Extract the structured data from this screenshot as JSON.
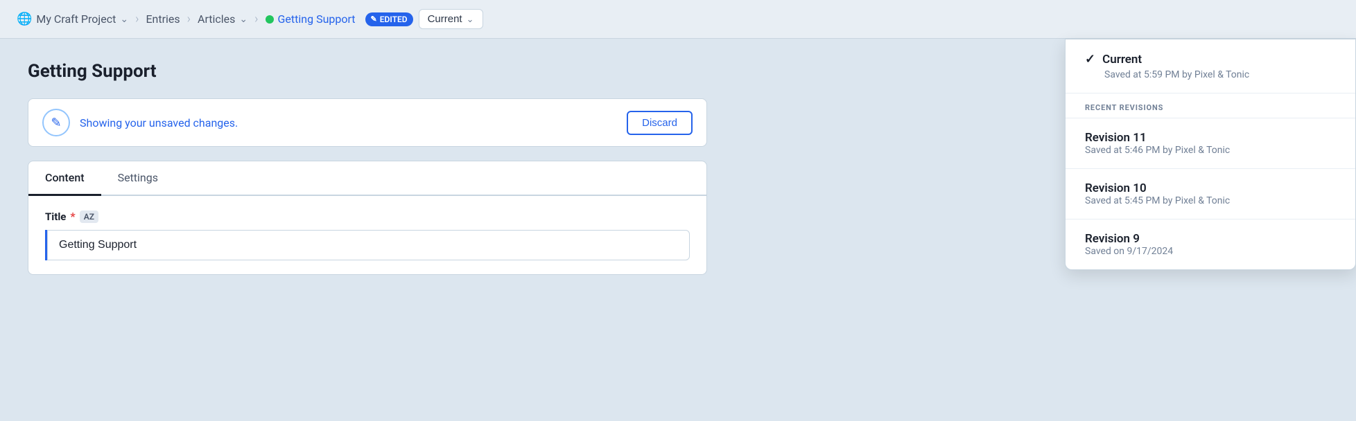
{
  "nav": {
    "project_label": "My Craft Project",
    "entries_label": "Entries",
    "articles_label": "Articles",
    "active_entry_label": "Getting Support",
    "edited_badge_label": "EDITED",
    "current_btn_label": "Current",
    "globe_icon": "🌐",
    "checkmark_icon": "✓",
    "edited_icon": "✎"
  },
  "page": {
    "title": "Getting Support"
  },
  "unsaved_banner": {
    "message": "Showing your unsaved changes.",
    "discard_label": "Discard"
  },
  "tabs": [
    {
      "label": "Content",
      "active": true
    },
    {
      "label": "Settings",
      "active": false
    }
  ],
  "title_field": {
    "label": "Title",
    "required": true,
    "translation_badge": "AZ",
    "value": "Getting Support"
  },
  "dropdown": {
    "current_item": {
      "title": "Current",
      "subtitle": "Saved at 5:59 PM by Pixel & Tonic",
      "selected": true
    },
    "recent_revisions_header": "RECENT REVISIONS",
    "revisions": [
      {
        "title": "Revision 11",
        "subtitle": "Saved at 5:46 PM by Pixel & Tonic"
      },
      {
        "title": "Revision 10",
        "subtitle": "Saved at 5:45 PM by Pixel & Tonic"
      },
      {
        "title": "Revision 9",
        "subtitle": "Saved on 9/17/2024"
      }
    ]
  },
  "colors": {
    "accent_blue": "#2563eb",
    "green_dot": "#22c55e",
    "text_dark": "#1a202c",
    "text_muted": "#718096"
  }
}
